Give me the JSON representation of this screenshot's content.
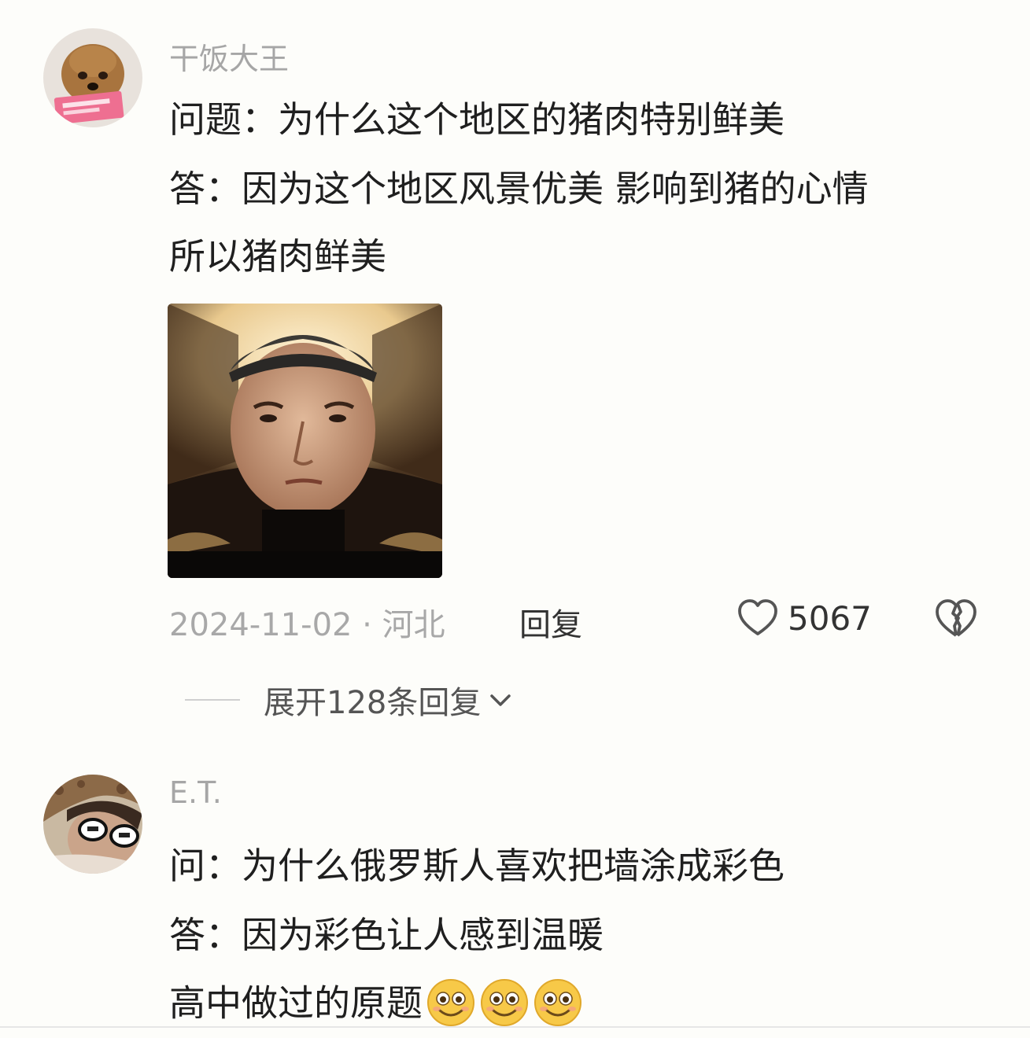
{
  "comments": [
    {
      "username": "干饭大王",
      "lines": [
        "问题：为什么这个地区的猪肉特别鲜美",
        "答：因为这个地区风景优美 影响到猪的心情",
        "所以猪肉鲜美"
      ],
      "meta": {
        "date_location": "2024-11-02 · 河北",
        "reply_label": "回复",
        "like_count": "5067"
      },
      "expand_label": "展开128条回复"
    },
    {
      "username": "E.T.",
      "lines": [
        "问：为什么俄罗斯人喜欢把墙涂成彩色",
        "答：因为彩色让人感到温暖",
        "高中做过的原题"
      ],
      "emojis": [
        "grin-eyes-emoji",
        "grin-eyes-emoji",
        "grin-eyes-emoji"
      ]
    }
  ],
  "colors": {
    "background": "#fdfdfa",
    "username": "#a6a6a6",
    "meta_text": "#a8a8a8",
    "emoji_yellow": "#f7c948"
  },
  "icons": [
    "heart-outline-icon",
    "broken-heart-icon",
    "chevron-down-icon"
  ]
}
